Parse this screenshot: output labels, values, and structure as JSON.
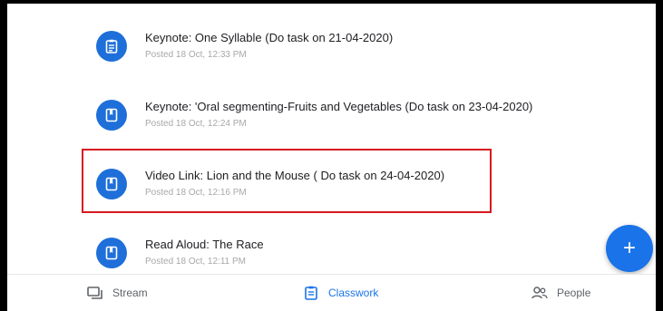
{
  "items": [
    {
      "title": "Keynote: One Syllable (Do task on 21-04-2020)",
      "meta": "Posted 18 Oct, 12:33 PM",
      "icon": "assignment-icon"
    },
    {
      "title": "Keynote: 'Oral segmenting-Fruits and Vegetables (Do task on 23-04-2020)",
      "meta": "Posted 18 Oct, 12:24 PM",
      "icon": "material-icon"
    },
    {
      "title": "Video Link: Lion and the Mouse ( Do task on 24-04-2020)",
      "meta": "Posted 18 Oct, 12:16 PM",
      "icon": "material-icon"
    },
    {
      "title": "Read Aloud: The Race",
      "meta": "Posted 18 Oct, 12:11 PM",
      "icon": "material-icon"
    }
  ],
  "fab": {
    "label": "+"
  },
  "nav": {
    "stream": "Stream",
    "classwork": "Classwork",
    "people": "People"
  },
  "colors": {
    "accent": "#1a73e8",
    "highlight": "#d71920",
    "icon_bg": "#1e6fd9"
  }
}
